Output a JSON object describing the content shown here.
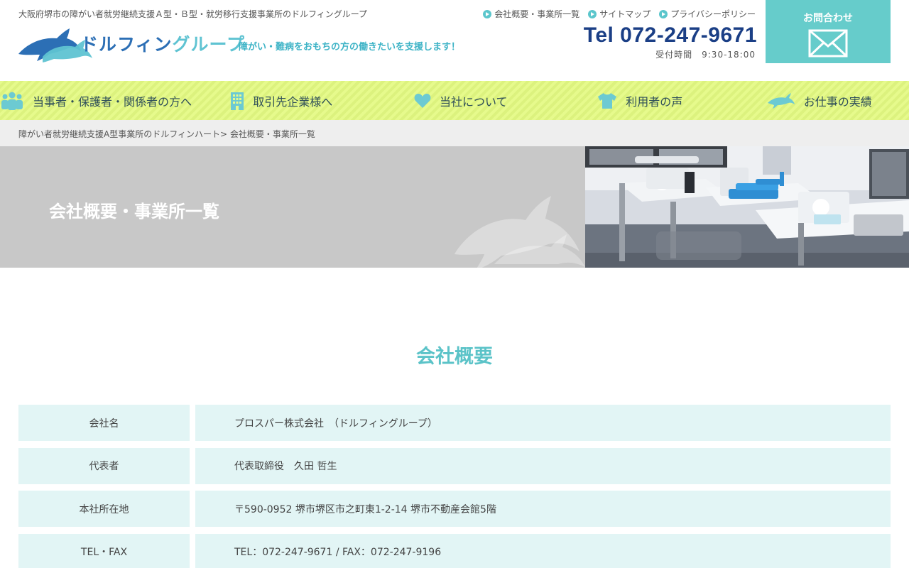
{
  "header": {
    "tagline": "大阪府堺市の障がい者就労継続支援Ａ型・Ｂ型・就労移行支援事業所のドルフィングループ",
    "logo_text_main": "ドルフィン",
    "logo_text_accent": "グループ",
    "slogan": "障がい・難病をおもちの方の働きたいを支援します！",
    "top_links": [
      {
        "label": "会社概要・事業所一覧"
      },
      {
        "label": "サイトマップ"
      },
      {
        "label": "プライバシーポリシー"
      }
    ],
    "tel": "Tel 072-247-9671",
    "hours": "受付時間　9:30-18:00",
    "contact_label": "お問合わせ"
  },
  "nav": {
    "items": [
      {
        "label": "当事者・保護者・関係者の方へ",
        "icon": "people-icon"
      },
      {
        "label": "取引先企業様へ",
        "icon": "building-icon"
      },
      {
        "label": "当社について",
        "icon": "heart-icon"
      },
      {
        "label": "利用者の声",
        "icon": "tshirt-icon"
      },
      {
        "label": "お仕事の実績",
        "icon": "dolphin-icon"
      }
    ]
  },
  "breadcrumb": {
    "home": "障がい者就労継続支援A型事業所のドルフィンハート",
    "separator": ">",
    "current": "会社概要・事業所一覧"
  },
  "hero": {
    "title": "会社概要・事業所一覧"
  },
  "company": {
    "section_title": "会社概要",
    "rows": [
      {
        "label": "会社名",
        "value": "プロスパー株式会社　（ドルフィングループ）"
      },
      {
        "label": "代表者",
        "value": "代表取締役　久田 哲生"
      },
      {
        "label": "本社所在地",
        "value": "〒590-0952 堺市堺区市之町東1-2-14 堺市不動産会館5階"
      },
      {
        "label": "TEL・FAX",
        "value": "TEL：072-247-9671 / FAX：072-247-9196"
      }
    ]
  },
  "colors": {
    "accent": "#66cccb",
    "nav_bg": "#e6fa8c",
    "tel": "#1b3f86",
    "table_bg": "#e2f5f5",
    "hero_bg": "#c8c8c8"
  }
}
